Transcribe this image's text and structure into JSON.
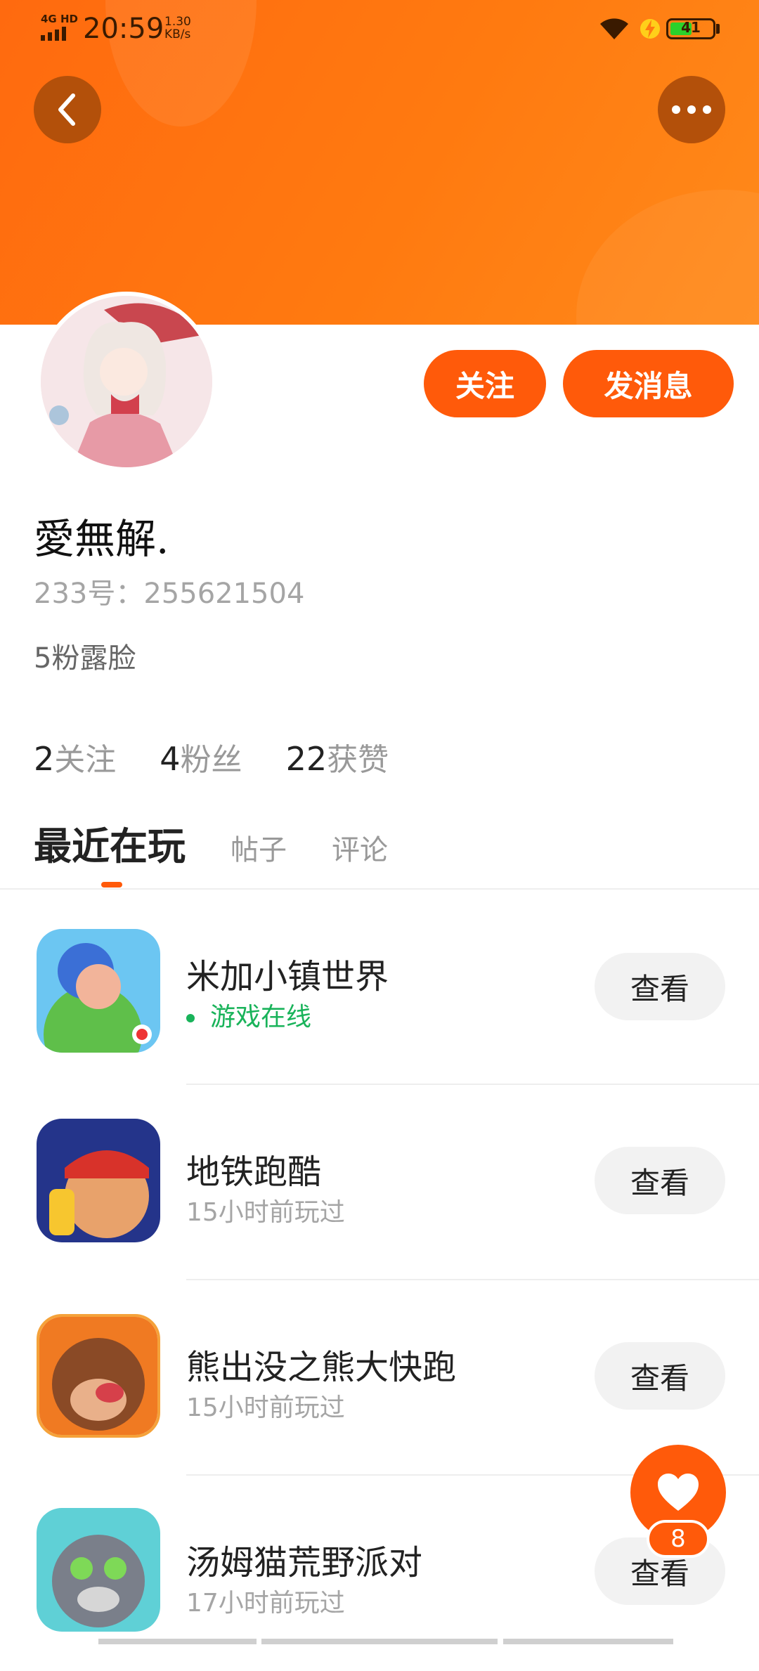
{
  "status_bar": {
    "network": "4G HD",
    "time": "20:59",
    "speed_value": "1.30",
    "speed_unit": "KB/s",
    "battery": "41"
  },
  "header": {
    "back_icon": "chevron-left-icon",
    "more_icon": "more-dots-icon",
    "gradient_colors": [
      "#ff6a0f",
      "#ff8a1a"
    ]
  },
  "profile": {
    "follow_label": "关注",
    "message_label": "发消息",
    "username": "愛無解.",
    "id_label": "233号：",
    "id_value": "255621504",
    "bio": "5粉露脸",
    "stats": [
      {
        "value": "2",
        "label": "关注"
      },
      {
        "value": "4",
        "label": "粉丝"
      },
      {
        "value": "22",
        "label": "获赞"
      }
    ]
  },
  "tabs": [
    {
      "label": "最近在玩",
      "active": true
    },
    {
      "label": "帖子",
      "active": false
    },
    {
      "label": "评论",
      "active": false
    }
  ],
  "games": [
    {
      "name": "米加小镇世界",
      "status": "游戏在线",
      "online": true,
      "action": "查看"
    },
    {
      "name": "地铁跑酷",
      "status": "15小时前玩过",
      "online": false,
      "action": "查看"
    },
    {
      "name": "熊出没之熊大快跑",
      "status": "15小时前玩过",
      "online": false,
      "action": "查看"
    },
    {
      "name": "汤姆猫荒野派对",
      "status": "17小时前玩过",
      "online": false,
      "action": "查看"
    }
  ],
  "like_fab": {
    "icon": "heart-icon",
    "count": "8"
  },
  "colors": {
    "accent": "#ff5a0a",
    "online": "#19b35a"
  }
}
